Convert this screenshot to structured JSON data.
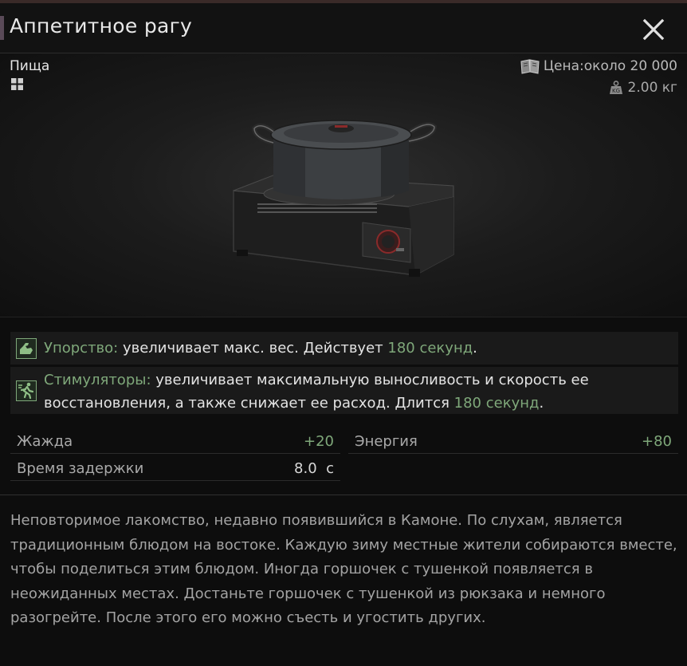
{
  "window": {
    "title": "Аппетитное рагу"
  },
  "item": {
    "category": "Пища",
    "price": "Цена:около 20 000",
    "weight": "2.00 кг"
  },
  "effects": [
    {
      "name": "Упорство:",
      "text_before": " увеличивает макс. вес. Действует ",
      "duration": "180 секунд",
      "text_after": "."
    },
    {
      "name": "Стимуляторы:",
      "text_before": " увеличивает максимальную выносливость и скорость ее восстановления, а также снижает ее расход. Длится ",
      "duration": "180 секунд",
      "text_after": "."
    }
  ],
  "stats": {
    "thirst": {
      "label": "Жажда",
      "value": "+20"
    },
    "energy": {
      "label": "Энергия",
      "value": "+80"
    },
    "delay": {
      "label": "Время задержки",
      "value": "8.0  с"
    }
  },
  "description": "Неповторимое лакомство, недавно появившийся в Камоне. По слухам, является традиционным блюдом на востоке. Каждую зиму местные жители собираются вместе, чтобы поделиться этим блюдом. Иногда горшочек с тушенкой появляется в неожиданных местах. Достаньте горшочек с тушенкой из рюкзака и немного разогрейте. После этого его можно съесть и угостить других.",
  "icons": {
    "close": "close-icon",
    "grid": "grid-icon",
    "price": "book-icon",
    "weight": "weight-icon",
    "effect1": "strength-arm-icon",
    "effect2": "running-man-icon"
  },
  "colors": {
    "accent_green": "#7fa87a",
    "background": "#0d0d0d",
    "panel": "#1a1a1a"
  }
}
